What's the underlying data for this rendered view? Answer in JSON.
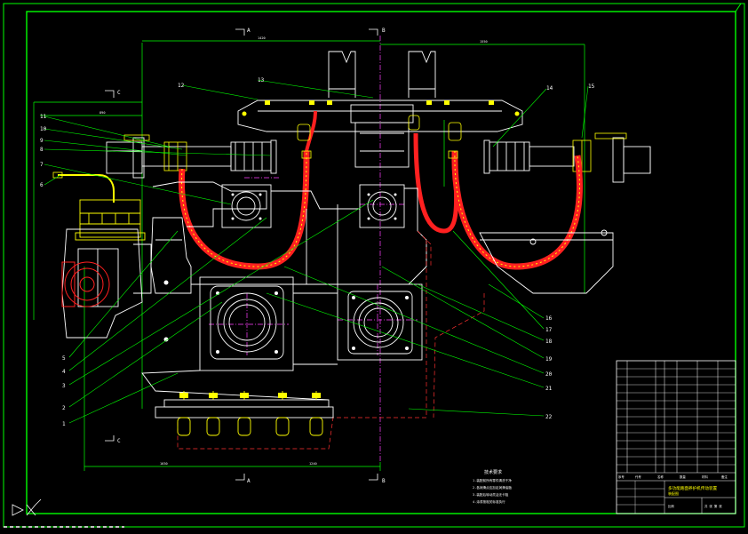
{
  "drawing": {
    "section_markers": {
      "a_top": "A",
      "b_top": "B",
      "c_left": "C",
      "c_bottom": "C",
      "a_bottom": "A",
      "b_bottom": "B"
    },
    "dimensions": {
      "top_a": "1420",
      "top_b": "1550",
      "left_top": "890",
      "bottom_left": "1030",
      "bottom_right": "1240"
    },
    "part_numbers_top": [
      "12",
      "13",
      "14",
      "15"
    ],
    "part_numbers_left": [
      "11",
      "10",
      "9",
      "8",
      "7",
      "6"
    ],
    "part_numbers_bottom_left": [
      "5",
      "4",
      "3",
      "2",
      "1"
    ],
    "part_numbers_right": [
      "16",
      "17",
      "18",
      "19",
      "20",
      "21",
      "22"
    ],
    "notes": {
      "title": "技术要求",
      "lines": [
        "1.装配前所有零件清洗干净",
        "2.各润滑点应加足润滑油脂",
        "3.装配后转动灵活无卡阻 ",
        "4.涂漆按相关标准执行"
      ]
    },
    "title_block": {
      "main_title": "多功能路面养护机传动装置",
      "sub_title": "装配图",
      "scale_label": "比例",
      "sheet_label": "共 张 第 张",
      "header_cells": [
        "序号",
        "代号",
        "名称",
        "数量",
        "材料",
        "备注"
      ]
    }
  },
  "colors": {
    "frame": "#00ff00",
    "outline": "#ffffff",
    "yellow": "#ffff00",
    "red": "#ff2020",
    "magenta": "#ff00ff",
    "cyan": "#00ffff"
  }
}
